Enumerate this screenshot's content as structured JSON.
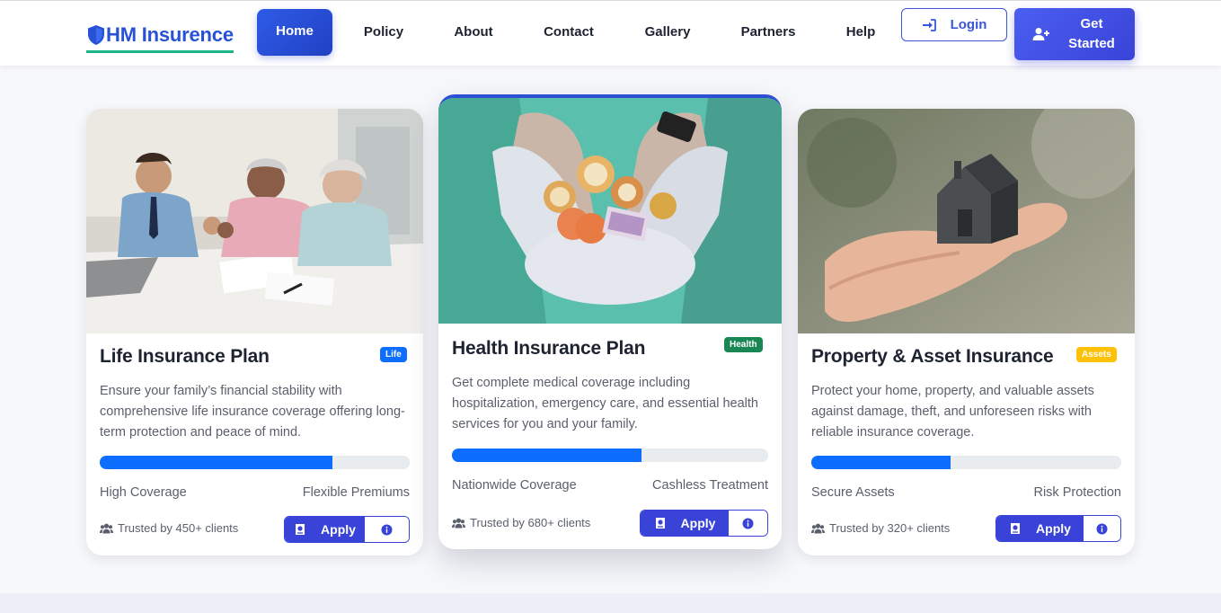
{
  "brand": {
    "name": "HM Insurence",
    "icon": "shield-icon"
  },
  "nav": {
    "items": [
      {
        "label": "Home",
        "active": true
      },
      {
        "label": "Policy"
      },
      {
        "label": "About"
      },
      {
        "label": "Contact"
      },
      {
        "label": "Gallery"
      },
      {
        "label": "Partners"
      },
      {
        "label": "Help"
      }
    ],
    "login_label": "Login",
    "get_started_label": "Get Started"
  },
  "cards": [
    {
      "title": "Life Insurance Plan",
      "badge": "Life",
      "badge_color": "#0d6efd",
      "description": "Ensure your family’s financial stability with comprehensive life insurance coverage offering long-term protection and peace of mind.",
      "progress": 0.75,
      "feature_left": "High Coverage",
      "feature_right": "Flexible Premiums",
      "trusted": "Trusted by 450+ clients",
      "apply_label": "Apply",
      "image": "photo of an advisor with an elderly couple at a table"
    },
    {
      "title": "Health Insurance Plan",
      "badge": "Health",
      "badge_color": "#198754",
      "description": "Get complete medical coverage including hospitalization, emergency care, and essential health services for you and your family.",
      "progress": 0.6,
      "feature_left": "Nationwide Coverage",
      "feature_right": "Cashless Treatment",
      "trusted": "Trusted by 680+ clients",
      "apply_label": "Apply",
      "image": "gloved hands holding coins and banknotes"
    },
    {
      "title": "Property & Asset Insurance",
      "badge": "Assets",
      "badge_color": "#ffc107",
      "description": "Protect your home, property, and valuable assets against damage, theft, and unforeseen risks with reliable insurance coverage.",
      "progress": 0.45,
      "feature_left": "Secure Assets",
      "feature_right": "Risk Protection",
      "trusted": "Trusted by 320+ clients",
      "apply_label": "Apply",
      "image": "hand holding a small model house"
    }
  ]
}
